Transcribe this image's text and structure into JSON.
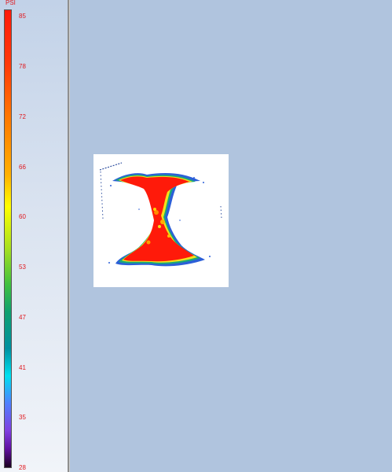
{
  "legend": {
    "unit": "PSI",
    "ticks": [
      "85",
      "78",
      "72",
      "66",
      "60",
      "53",
      "47",
      "41",
      "35",
      "28"
    ]
  },
  "colors": {
    "background": "#b0c4de",
    "pressure_high": "#ff1a0a",
    "pressure_mid": "#ffff00",
    "pressure_low": "#1a0020"
  }
}
